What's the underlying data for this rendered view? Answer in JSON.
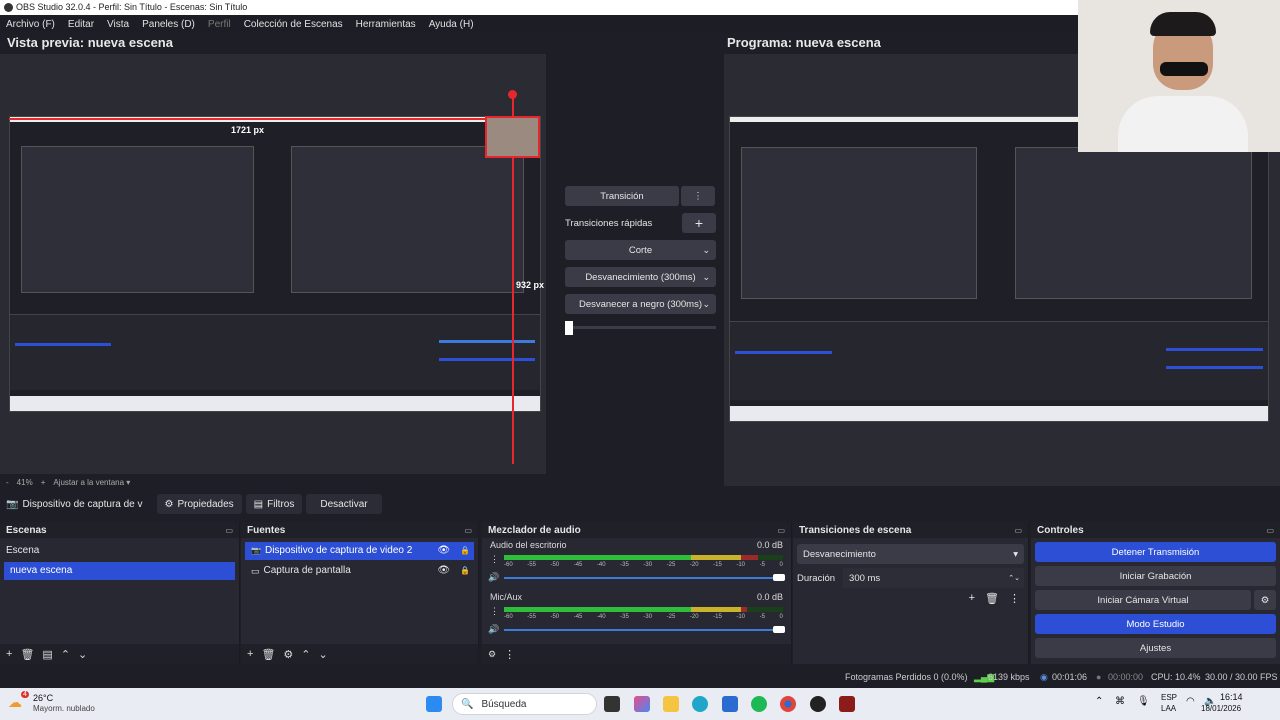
{
  "titlebar": {
    "text": "OBS Studio 32.0.4 - Perfil: Sin Título - Escenas: Sin Título"
  },
  "menu": [
    {
      "label": "Archivo (F)",
      "enabled": true
    },
    {
      "label": "Editar",
      "enabled": true
    },
    {
      "label": "Vista",
      "enabled": true
    },
    {
      "label": "Paneles (D)",
      "enabled": true
    },
    {
      "label": "Perfil",
      "enabled": false
    },
    {
      "label": "Colección de Escenas",
      "enabled": true
    },
    {
      "label": "Herramientas",
      "enabled": true
    },
    {
      "label": "Ayuda (H)",
      "enabled": true
    }
  ],
  "preview": {
    "title": "Vista previa: nueva escena",
    "width_label": "1721 px",
    "height_label": "932 px"
  },
  "program": {
    "title": "Programa: nueva escena"
  },
  "zoom": {
    "minus": "-",
    "value": "41%",
    "plus": "+",
    "fit_label": "Ajustar a la ventana"
  },
  "source_toolbar": {
    "source_name": "Dispositivo de captura de v",
    "properties": "Propiedades",
    "filters": "Filtros",
    "deactivate": "Desactivar"
  },
  "transition_panel": {
    "transition_button": "Transición",
    "quick_label": "Transiciones rápidas",
    "quick": [
      "Corte",
      "Desvanecimiento (300ms)",
      "Desvanecer a negro (300ms)"
    ]
  },
  "scenes": {
    "title": "Escenas",
    "items": [
      "Escena",
      "nueva escena"
    ],
    "selected": 1
  },
  "sources": {
    "title": "Fuentes",
    "items": [
      {
        "name": "Dispositivo de captura de video 2",
        "selected": true
      },
      {
        "name": "Captura de pantalla",
        "selected": false
      }
    ]
  },
  "mixer": {
    "title": "Mezclador de audio",
    "scale": [
      "-60",
      "-55",
      "-50",
      "-45",
      "-40",
      "-35",
      "-30",
      "-25",
      "-20",
      "-15",
      "-10",
      "-5",
      "0"
    ],
    "channels": [
      {
        "name": "Audio del escritorio",
        "db": "0.0 dB",
        "level": 0.91
      },
      {
        "name": "Mic/Aux",
        "db": "0.0 dB",
        "level": 0.87
      }
    ]
  },
  "scene_transitions": {
    "title": "Transiciones de escena",
    "type": "Desvanecimiento",
    "duration_label": "Duración",
    "duration_value": "300 ms"
  },
  "controls": {
    "title": "Controles",
    "stop_stream": "Detener Transmisión",
    "start_record": "Iniciar Grabación",
    "virtual_cam": "Iniciar Cámara Virtual",
    "studio_mode": "Modo Estudio",
    "settings": "Ajustes"
  },
  "status": {
    "dropped": "Fotogramas Perdidos 0 (0.0%)",
    "bitrate": "6139 kbps",
    "stream_time": "00:01:06",
    "rec_time": "00:00:00",
    "cpu": "CPU: 10.4%",
    "fps": "30.00 / 30.00 FPS"
  },
  "taskbar": {
    "weather_temp": "26°C",
    "weather_desc": "Mayorm. nublado",
    "weather_badge": "4",
    "search_placeholder": "Búsqueda",
    "lang_top": "ESP",
    "lang_bottom": "LAA",
    "time": "16:14",
    "date": "18/01/2026"
  },
  "colors": {
    "accent": "#2c4fd6",
    "selection": "#e8262e",
    "meter_green": "#2fbd3c"
  }
}
